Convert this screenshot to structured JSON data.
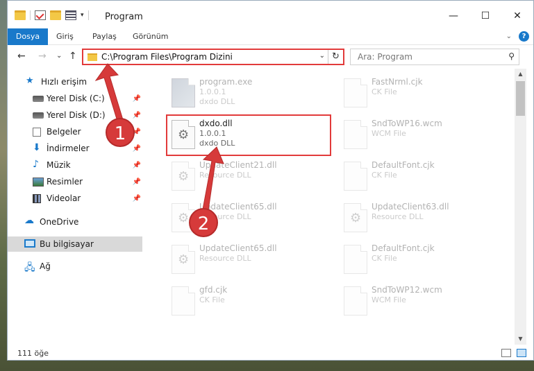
{
  "window": {
    "title": "Program"
  },
  "controls": {
    "minimize": "—",
    "maximize": "☐",
    "close": "✕"
  },
  "ribbon": {
    "tabs": [
      "Dosya",
      "Giriş",
      "Paylaş",
      "Görünüm"
    ],
    "help": "?"
  },
  "nav": {
    "back": "←",
    "forward": "→",
    "recent": "⌄",
    "up": "↑",
    "address": "C:\\Program Files\\Program Dizini",
    "refresh": "↻",
    "search_placeholder": "Ara: Program"
  },
  "sidebar": {
    "items": [
      {
        "label": "Hızlı erişim",
        "icon": "star-icon"
      },
      {
        "label": "Yerel Disk (C:)",
        "icon": "drive-icon",
        "pinned": true
      },
      {
        "label": "Yerel Disk (D:)",
        "icon": "drive-icon",
        "pinned": true
      },
      {
        "label": "Belgeler",
        "icon": "documents-icon",
        "pinned": true
      },
      {
        "label": "İndirmeler",
        "icon": "download-icon",
        "pinned": true
      },
      {
        "label": "Müzik",
        "icon": "music-icon",
        "pinned": true
      },
      {
        "label": "Resimler",
        "icon": "pictures-icon",
        "pinned": true
      },
      {
        "label": "Videolar",
        "icon": "videos-icon",
        "pinned": true
      },
      {
        "label": "OneDrive",
        "icon": "onedrive-icon"
      },
      {
        "label": "Bu bilgisayar",
        "icon": "this-pc-icon",
        "selected": true
      },
      {
        "label": "Ağ",
        "icon": "network-icon"
      }
    ]
  },
  "files": {
    "left": [
      {
        "name": "program.exe",
        "line2": "1.0.0.1",
        "line3": "dxdo DLL"
      },
      {
        "name": "dxdo.dll",
        "line2": "1.0.0.1",
        "line3": "dxdo DLL"
      },
      {
        "name": "UpdateClient21.dll",
        "line2": "Resource DLL",
        "line3": ""
      },
      {
        "name": "UpdateClient65.dll",
        "line2": "Resource DLL",
        "line3": ""
      },
      {
        "name": "UpdateClient65.dll",
        "line2": "Resource DLL",
        "line3": ""
      },
      {
        "name": "gfd.cjk",
        "line2": "CK File",
        "line3": ""
      }
    ],
    "right": [
      {
        "name": "FastNrml.cjk",
        "line2": "CK File",
        "line3": ""
      },
      {
        "name": "SndToWP16.wcm",
        "line2": "WCM File",
        "line3": ""
      },
      {
        "name": "DefaultFont.cjk",
        "line2": "CK File",
        "line3": ""
      },
      {
        "name": "UpdateClient63.dll",
        "line2": "Resource DLL",
        "line3": ""
      },
      {
        "name": "DefaultFont.cjk",
        "line2": "CK File",
        "line3": ""
      },
      {
        "name": "SndToWP12.wcm",
        "line2": "WCM File",
        "line3": ""
      }
    ]
  },
  "status": {
    "count": "111 öğe"
  },
  "annotations": {
    "callout1": "1",
    "callout2": "2",
    "color": "#d63a3a"
  }
}
